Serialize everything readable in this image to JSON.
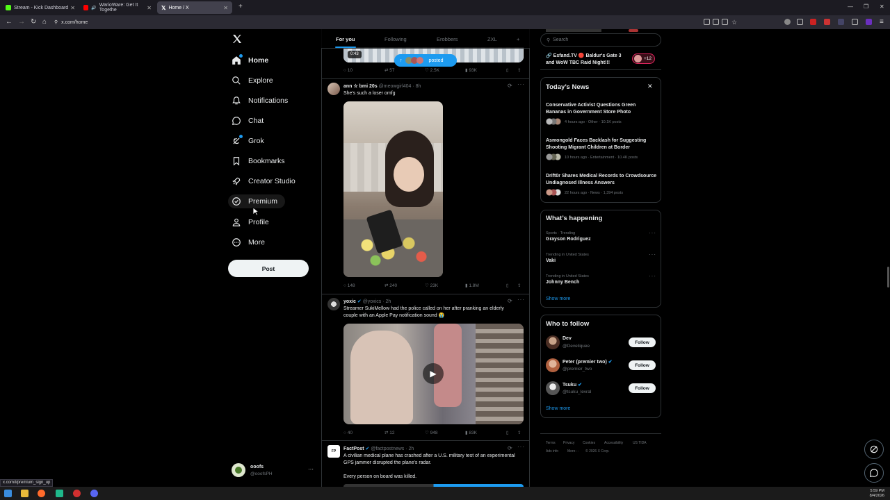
{
  "browser": {
    "tabs": [
      {
        "label": "Stream - Kick Dashboard",
        "color": "#53fc18"
      },
      {
        "label": "WarioWare: Get It Togethe",
        "color": "#ff0000"
      },
      {
        "label": "Home / X",
        "color": "#ffffff"
      }
    ],
    "url": "x.com/home",
    "status_url": "x.com/i/premium_sign_up"
  },
  "sidebar": {
    "items": [
      {
        "label": "Home",
        "icon": "home-icon"
      },
      {
        "label": "Explore",
        "icon": "search-icon"
      },
      {
        "label": "Notifications",
        "icon": "bell-icon"
      },
      {
        "label": "Chat",
        "icon": "chat-icon"
      },
      {
        "label": "Grok",
        "icon": "grok-icon"
      },
      {
        "label": "Bookmarks",
        "icon": "bookmark-icon"
      },
      {
        "label": "Creator Studio",
        "icon": "rocket-icon"
      },
      {
        "label": "Premium",
        "icon": "premium-icon"
      },
      {
        "label": "Profile",
        "icon": "person-icon"
      },
      {
        "label": "More",
        "icon": "more-circle-icon"
      }
    ],
    "post_label": "Post",
    "account": {
      "name": "ooofs",
      "handle": "@ooofsPH"
    }
  },
  "feed": {
    "tabs": [
      "For you",
      "Following",
      "Erobbers",
      "ZXL"
    ],
    "posted_pill": "posted",
    "top_post": {
      "duration": "0:43",
      "replies": "10",
      "reposts": "57",
      "likes": "2.5K",
      "views": "93K"
    },
    "posts": [
      {
        "name": "ann ☆ bmi 20s",
        "handle": "@meowgirl404",
        "time": "· 8h",
        "text": "She's such a loser omfg",
        "replies": "148",
        "reposts": "240",
        "likes": "23K",
        "views": "1.8M"
      },
      {
        "name": "yoxic",
        "handle": "@yoxics",
        "time": "· 2h",
        "text": "Streamer SukiMellow had the police called on her after pranking an elderly couple with an Apple Pay notification sound 😭",
        "replies": "40",
        "reposts": "12",
        "likes": "948",
        "views": "83K"
      },
      {
        "name": "FactPost",
        "handle": "@factpostnews",
        "time": "· 2h",
        "text": "A civilian medical plane has crashed after a U.S. military test of an experimental GPS jammer disrupted the plane's radar.",
        "text2": "Every person on board was killed."
      }
    ]
  },
  "right": {
    "search_placeholder": "Search",
    "live": {
      "title": "Esfand.TV 🔴 Baldur's Gate 3 and WoW TBC Raid Night!!!",
      "count": "+12"
    },
    "news": {
      "title": "Today’s News",
      "items": [
        {
          "headline": "Conservative Activist Questions Green Bananas in Government Store Photo",
          "meta": "4 hours ago · Other · 10.1K posts"
        },
        {
          "headline": "Asmongold Faces Backlash for Suggesting Shooting Migrant Children at Border",
          "meta": "10 hours ago · Entertainment · 10.4K posts"
        },
        {
          "headline": "Drift0r Shares Medical Records to Crowdsource Undiagnosed Illness Answers",
          "meta": "22 hours ago · News · 1,394 posts"
        }
      ]
    },
    "happening": {
      "title": "What’s happening",
      "items": [
        {
          "meta": "Sports · Trending",
          "topic": "Grayson Rodriguez"
        },
        {
          "meta": "Trending in United States",
          "topic": "Vaki"
        },
        {
          "meta": "Trending in United States",
          "topic": "Johnny Bench"
        }
      ],
      "show_more": "Show more"
    },
    "who_to_follow": {
      "title": "Who to follow",
      "items": [
        {
          "name": "Dev",
          "handle": "@Develiquee",
          "verified": false
        },
        {
          "name": "Peter (premier two)",
          "handle": "@premier_two",
          "verified": true
        },
        {
          "name": "Tsuku",
          "handle": "@tsuku_levral",
          "verified": true
        }
      ],
      "follow_label": "Follow",
      "show_more": "Show more"
    },
    "footer": {
      "links": [
        "Terms",
        "Privacy",
        "Cookies",
        "Accessibility",
        "US TIDA",
        "Ads info",
        "More···",
        "© 2026 X Corp."
      ]
    }
  },
  "taskbar": {
    "time": "5:59 PM",
    "date": "8/4/2026"
  },
  "colors": {
    "accent": "#1d9bf0",
    "background": "#000000",
    "border": "#2f3336",
    "muted": "#71767b"
  }
}
